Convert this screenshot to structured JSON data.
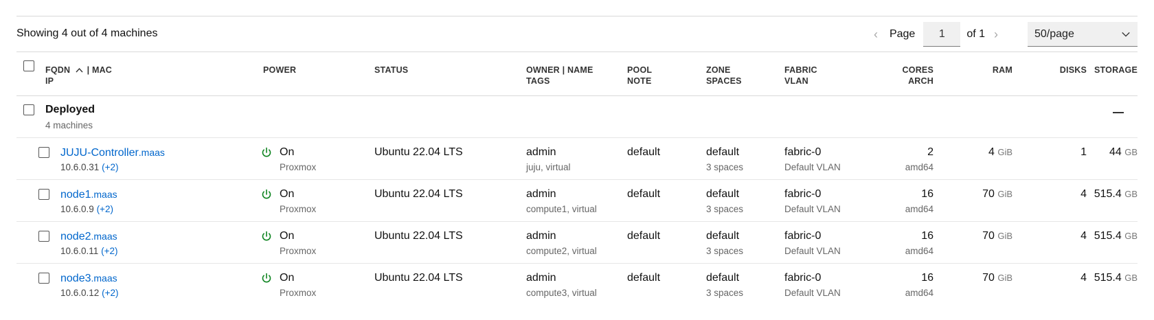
{
  "header": {
    "count_text": "Showing 4 out of 4 machines",
    "page_label": "Page",
    "page_value": "1",
    "of_label": "of 1",
    "per_page": "50/page"
  },
  "columns": {
    "fqdn": "FQDN",
    "mac": "| MAC",
    "ip": "IP",
    "power": "POWER",
    "status": "STATUS",
    "owner": "OWNER | NAME",
    "tags": "TAGS",
    "pool": "POOL",
    "note": "NOTE",
    "zone": "ZONE",
    "spaces": "SPACES",
    "fabric": "FABRIC",
    "vlan": "VLAN",
    "cores": "CORES",
    "arch": "ARCH",
    "ram": "RAM",
    "disks": "DISKS",
    "storage": "STORAGE"
  },
  "group": {
    "title": "Deployed",
    "subtitle": "4 machines"
  },
  "machines": [
    {
      "hostname": "JUJU-Controller",
      "domain": ".maas",
      "ip": "10.6.0.31",
      "ip_extra": "(+2)",
      "power": "On",
      "power_type": "Proxmox",
      "status": "Ubuntu 22.04 LTS",
      "owner": "admin",
      "tags": "juju, virtual",
      "pool": "default",
      "zone": "default",
      "spaces": "3 spaces",
      "fabric": "fabric-0",
      "vlan": "Default VLAN",
      "cores": "2",
      "arch": "amd64",
      "ram": "4",
      "ram_unit": "GiB",
      "disks": "1",
      "storage": "44",
      "storage_unit": "GB"
    },
    {
      "hostname": "node1",
      "domain": ".maas",
      "ip": "10.6.0.9",
      "ip_extra": "(+2)",
      "power": "On",
      "power_type": "Proxmox",
      "status": "Ubuntu 22.04 LTS",
      "owner": "admin",
      "tags": "compute1, virtual",
      "pool": "default",
      "zone": "default",
      "spaces": "3 spaces",
      "fabric": "fabric-0",
      "vlan": "Default VLAN",
      "cores": "16",
      "arch": "amd64",
      "ram": "70",
      "ram_unit": "GiB",
      "disks": "4",
      "storage": "515.4",
      "storage_unit": "GB"
    },
    {
      "hostname": "node2",
      "domain": ".maas",
      "ip": "10.6.0.11",
      "ip_extra": "(+2)",
      "power": "On",
      "power_type": "Proxmox",
      "status": "Ubuntu 22.04 LTS",
      "owner": "admin",
      "tags": "compute2, virtual",
      "pool": "default",
      "zone": "default",
      "spaces": "3 spaces",
      "fabric": "fabric-0",
      "vlan": "Default VLAN",
      "cores": "16",
      "arch": "amd64",
      "ram": "70",
      "ram_unit": "GiB",
      "disks": "4",
      "storage": "515.4",
      "storage_unit": "GB"
    },
    {
      "hostname": "node3",
      "domain": ".maas",
      "ip": "10.6.0.12",
      "ip_extra": "(+2)",
      "power": "On",
      "power_type": "Proxmox",
      "status": "Ubuntu 22.04 LTS",
      "owner": "admin",
      "tags": "compute3, virtual",
      "pool": "default",
      "zone": "default",
      "spaces": "3 spaces",
      "fabric": "fabric-0",
      "vlan": "Default VLAN",
      "cores": "16",
      "arch": "amd64",
      "ram": "70",
      "ram_unit": "GiB",
      "disks": "4",
      "storage": "515.4",
      "storage_unit": "GB"
    }
  ],
  "colors": {
    "link": "#0066cc",
    "power_on": "#0e8420",
    "muted": "#666666"
  }
}
